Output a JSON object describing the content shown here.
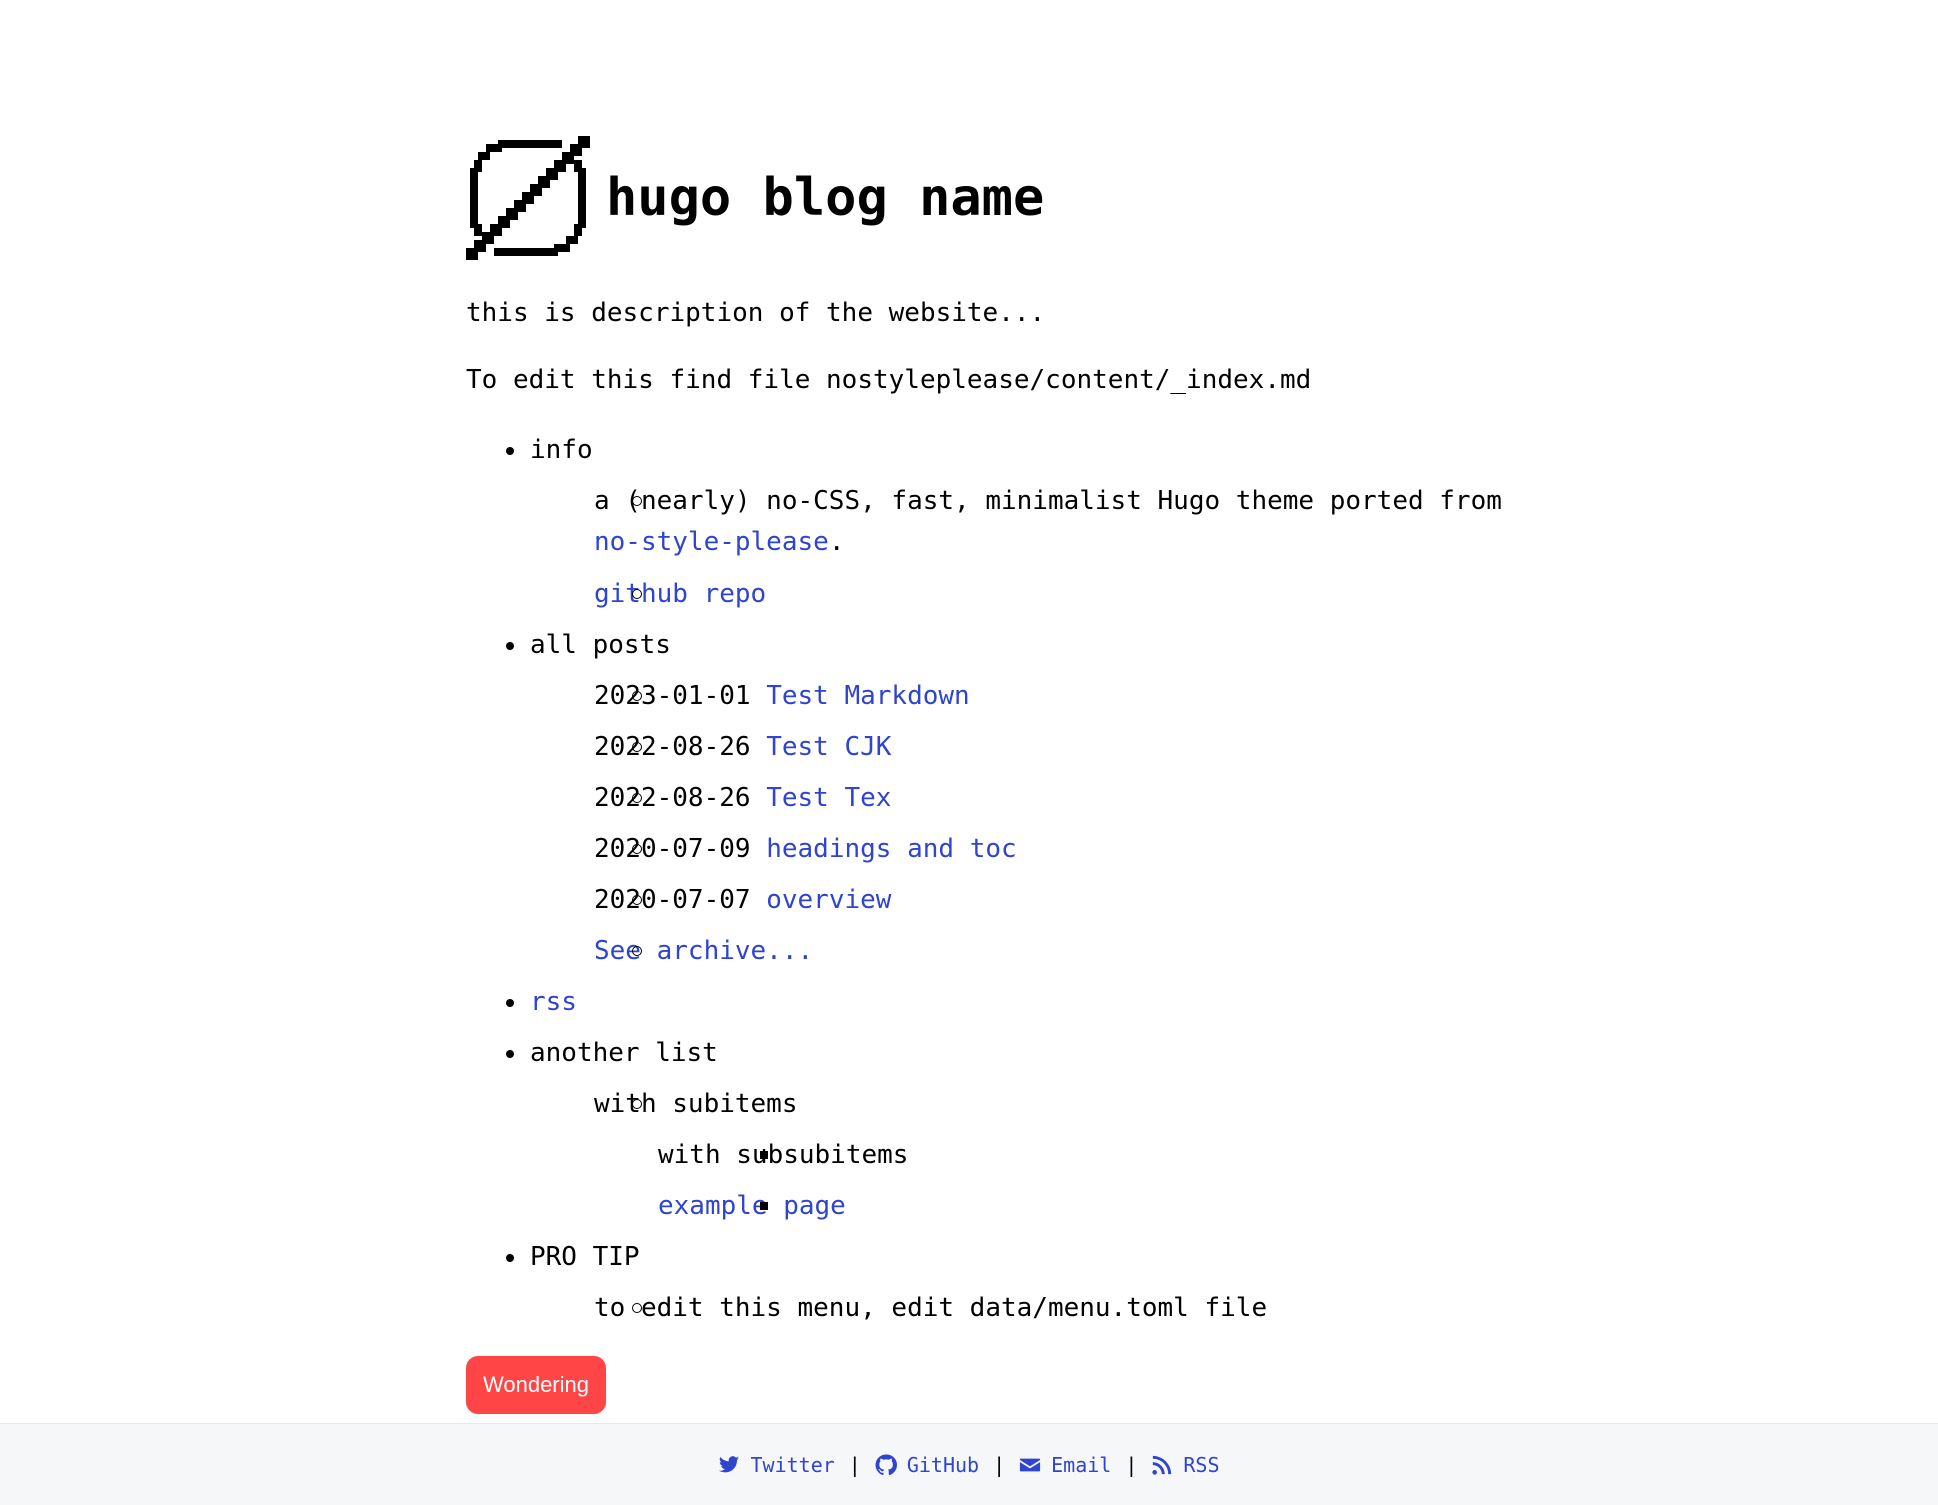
{
  "header": {
    "logo_icon": "slashed-circle-icon",
    "title": "hugo blog name"
  },
  "description": {
    "line1": "this is description of the website...",
    "line2": "To edit this find file nostyleplease/content/_index.md"
  },
  "menu": {
    "info": {
      "label": "info",
      "desc_text": "a (nearly) no-CSS, fast, minimalist Hugo theme ported from",
      "desc_link": "no-style-please",
      "desc_end": ".",
      "repo_link": "github repo"
    },
    "posts": {
      "label": "all posts",
      "items": [
        {
          "date": "2023-01-01",
          "title": "Test Markdown"
        },
        {
          "date": "2022-08-26",
          "title": "Test CJK"
        },
        {
          "date": "2022-08-26",
          "title": "Test Tex"
        },
        {
          "date": "2020-07-09",
          "title": "headings and toc"
        },
        {
          "date": "2020-07-07",
          "title": "overview"
        }
      ],
      "archive_link": "See archive..."
    },
    "rss": {
      "label": "rss"
    },
    "another": {
      "label": "another list",
      "sub_label": "with subitems",
      "subsub_label": "with subsubitems",
      "example_link": "example page"
    },
    "protip": {
      "label": "PRO TIP",
      "text": "to edit this menu, edit data/menu.toml file"
    }
  },
  "tag_button": {
    "label": "Wondering",
    "color": "#ff4545"
  },
  "footer": {
    "twitter": {
      "label": "Twitter",
      "icon": "twitter-icon"
    },
    "github": {
      "label": "GitHub",
      "icon": "github-icon"
    },
    "email": {
      "label": "Email",
      "icon": "envelope-icon"
    },
    "rss": {
      "label": "RSS",
      "icon": "rss-icon"
    },
    "separator": "|"
  },
  "colors": {
    "link": "#2f44cf",
    "text": "#000000",
    "footer_bg": "#f6f7f9"
  }
}
